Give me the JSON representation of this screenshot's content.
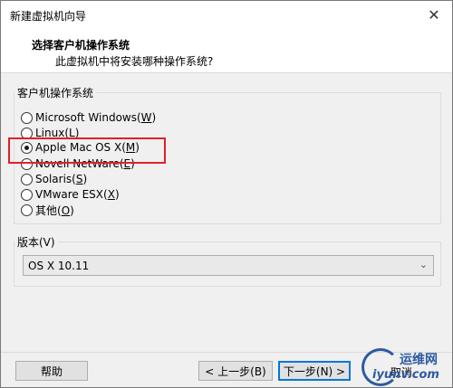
{
  "window": {
    "title": "新建虚拟机向导",
    "close_glyph": "✕"
  },
  "header": {
    "title": "选择客户机操作系统",
    "subtitle": "此虚拟机中将安装哪种操作系统?"
  },
  "os_group": {
    "label": "客户机操作系统",
    "options": [
      {
        "label": "Microsoft Windows",
        "key": "W",
        "checked": false
      },
      {
        "label": "Linux",
        "key": "L",
        "checked": false
      },
      {
        "label": "Apple Mac OS X",
        "key": "M",
        "checked": true
      },
      {
        "label": "Novell NetWare",
        "key": "E",
        "checked": false
      },
      {
        "label": "Solaris",
        "key": "S",
        "checked": false
      },
      {
        "label": "VMware ESX",
        "key": "X",
        "checked": false
      },
      {
        "label": "其他",
        "key": "O",
        "checked": false
      }
    ]
  },
  "version_group": {
    "label": "版本(V)",
    "selected": "OS X 10.11"
  },
  "buttons": {
    "help": "帮助",
    "back": "< 上一步(B)",
    "next": "下一步(N) >",
    "cancel": "取消"
  },
  "watermark": {
    "cn": "运维网",
    "en": "iyunv.com"
  },
  "colors": {
    "highlight": "#e0202a",
    "accent": "#0078d7"
  }
}
